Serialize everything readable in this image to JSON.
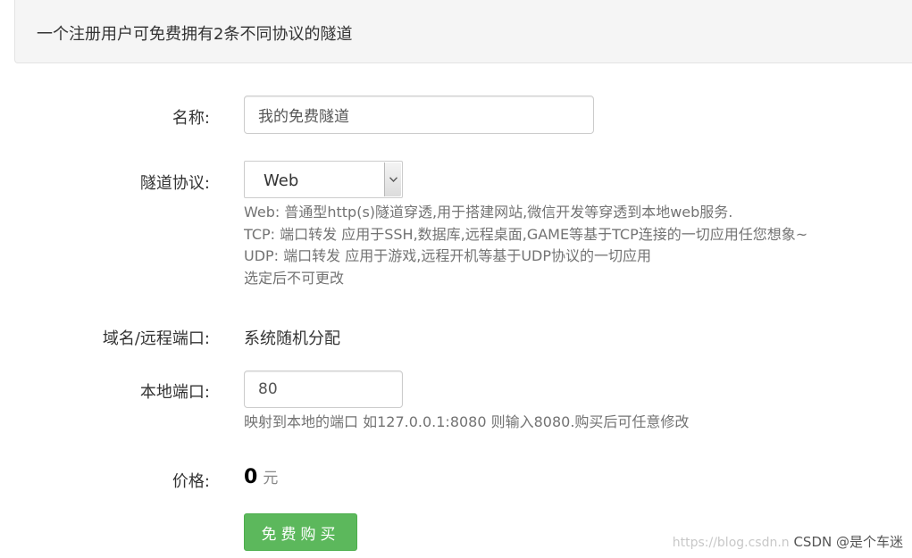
{
  "notice": "一个注册用户可免费拥有2条不同协议的隧道",
  "form": {
    "name": {
      "label": "名称:",
      "value": "我的免费隧道"
    },
    "protocol": {
      "label": "隧道协议:",
      "selected": "Web",
      "help": [
        "Web: 普通型http(s)隧道穿透,用于搭建网站,微信开发等穿透到本地web服务.",
        "TCP: 端口转发 应用于SSH,数据库,远程桌面,GAME等基于TCP连接的一切应用任您想象~",
        "UDP: 端口转发 应用于游戏,远程开机等基于UDP协议的一切应用",
        "选定后不可更改"
      ]
    },
    "domain": {
      "label": "域名/远程端口:",
      "value": "系统随机分配"
    },
    "local_port": {
      "label": "本地端口:",
      "value": "80",
      "help": "映射到本地的端口 如127.0.0.1:8080 则输入8080.购买后可任意修改"
    },
    "price": {
      "label": "价格:",
      "amount": "0",
      "unit": "元"
    },
    "buy_button": "免费购买"
  },
  "watermark": {
    "url": "https://blog.csdn.n",
    "brand": "CSDN @是个车迷"
  },
  "icons": {
    "select_arrow": "chevron-down-icon"
  },
  "colors": {
    "primary_button": "#5cb85c",
    "help_text": "#737373",
    "notice_bg": "#f5f5f5"
  }
}
